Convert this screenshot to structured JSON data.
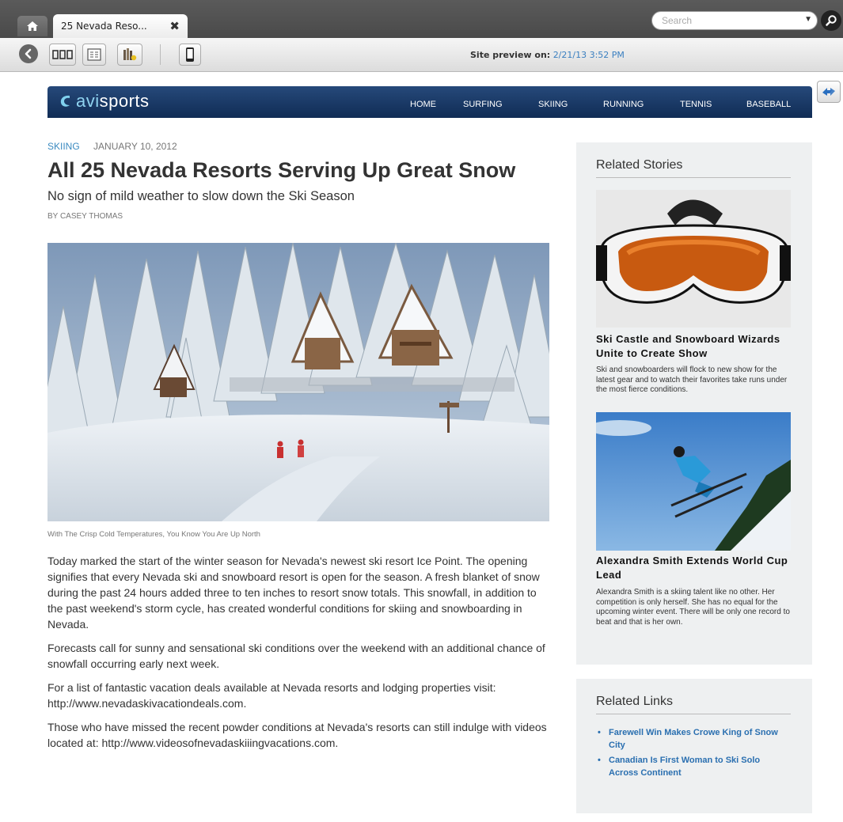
{
  "browser": {
    "tab_title": "25 Nevada Reso...",
    "tab_close": "✖",
    "search_placeholder": "Search",
    "preview_label": "Site preview on:",
    "preview_date": "2/21/13 3:52 PM"
  },
  "site": {
    "logo_prefix": "avi",
    "logo_suffix": "sports",
    "nav": [
      "HOME",
      "SURFING",
      "SKIING",
      "RUNNING",
      "TENNIS",
      "BASEBALL"
    ]
  },
  "article": {
    "category": "SKIING",
    "date": "JANUARY 10, 2012",
    "headline": "All 25 Nevada Resorts Serving Up Great Snow",
    "subhead": "No sign of mild weather to slow down the Ski Season",
    "byline": "BY CASEY THOMAS",
    "caption": "With The Crisp Cold Temperatures, You Know You Are Up North",
    "paragraphs": [
      "Today marked the start of the winter season for Nevada's newest ski resort Ice Point. The opening signifies that every Nevada ski and snowboard resort is open for the season. A fresh blanket of snow during the past 24 hours added three to ten inches to resort snow totals. This snowfall, in addition to the past weekend's storm cycle, has created wonderful conditions for skiing and snowboarding in Nevada.",
      "Forecasts call for sunny and sensational ski conditions over the weekend with an additional chance of snowfall occurring early next week.",
      "For a list of fantastic vacation deals available at Nevada resorts and lodging properties visit: http://www.nevadaskivacationdeals.com.",
      "Those who have missed the recent powder conditions at Nevada's resorts can still indulge with videos located at: http://www.videosofnevadaskiiingvacations.com."
    ]
  },
  "sidebar": {
    "related_stories_title": "Related Stories",
    "stories": [
      {
        "title": "Ski Castle and Snowboard Wizards Unite to Create Show",
        "summary": "Ski and snowboarders will flock to new show for the latest gear and to watch their favorites take runs under the most fierce conditions."
      },
      {
        "title": "Alexandra Smith Extends World Cup Lead",
        "summary": "Alexandra Smith is a skiing talent like no other. Her competition is only herself. She has no equal for the upcoming winter event. There will be only one record to beat and that is her own."
      }
    ],
    "related_links_title": "Related Links",
    "links": [
      "Farewell Win Makes Crowe King of Snow City",
      "Canadian Is First Woman to Ski Solo Across Continent"
    ]
  }
}
